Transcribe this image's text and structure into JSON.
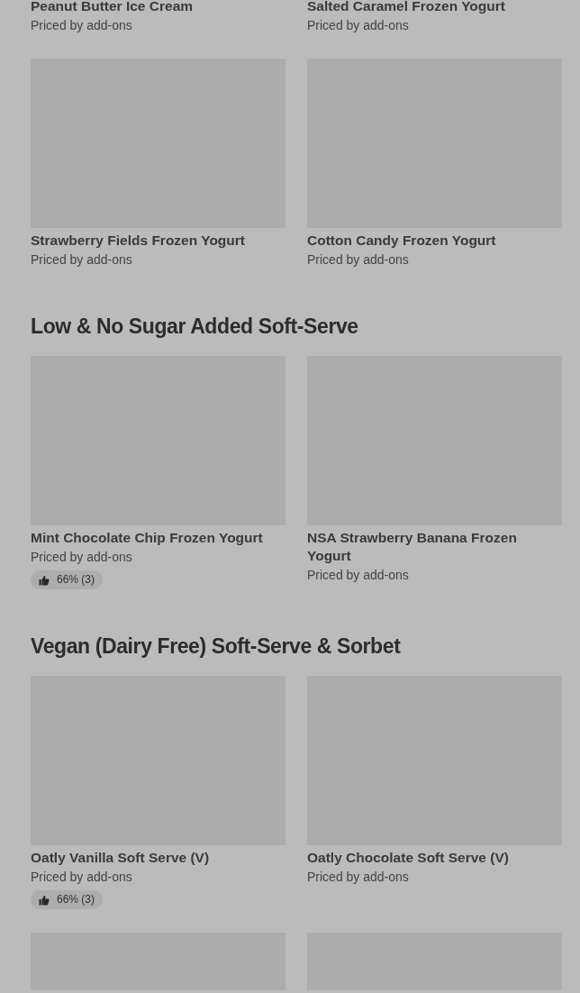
{
  "sections": [
    {
      "items": [
        {
          "kind": "caption",
          "name": "Peanut Butter Ice Cream",
          "price": "Priced by add-ons"
        },
        {
          "kind": "caption",
          "name": "Salted Caramel Frozen Yogurt",
          "price": "Priced by add-ons"
        },
        {
          "kind": "item",
          "name": "Strawberry Fields Frozen Yogurt",
          "price": "Priced by add-ons"
        },
        {
          "kind": "item",
          "name": "Cotton Candy Frozen Yogurt",
          "price": "Priced by add-ons"
        }
      ]
    },
    {
      "title": "Low & No Sugar Added Soft-Serve",
      "items": [
        {
          "kind": "item",
          "name": "Mint Chocolate Chip Frozen Yogurt",
          "price": "Priced by add-ons",
          "rating": "66% (3)"
        },
        {
          "kind": "item",
          "name": "NSA Strawberry Banana Frozen Yogurt",
          "price": "Priced by add-ons"
        }
      ]
    },
    {
      "title": "Vegan (Dairy Free) Soft-Serve & Sorbet",
      "items": [
        {
          "kind": "item",
          "name": "Oatly Vanilla Soft Serve (V)",
          "price": "Priced by add-ons",
          "rating": "66% (3)"
        },
        {
          "kind": "item",
          "name": "Oatly Chocolate Soft Serve (V)",
          "price": "Priced by add-ons"
        },
        {
          "kind": "picture"
        },
        {
          "kind": "picture"
        }
      ]
    }
  ]
}
